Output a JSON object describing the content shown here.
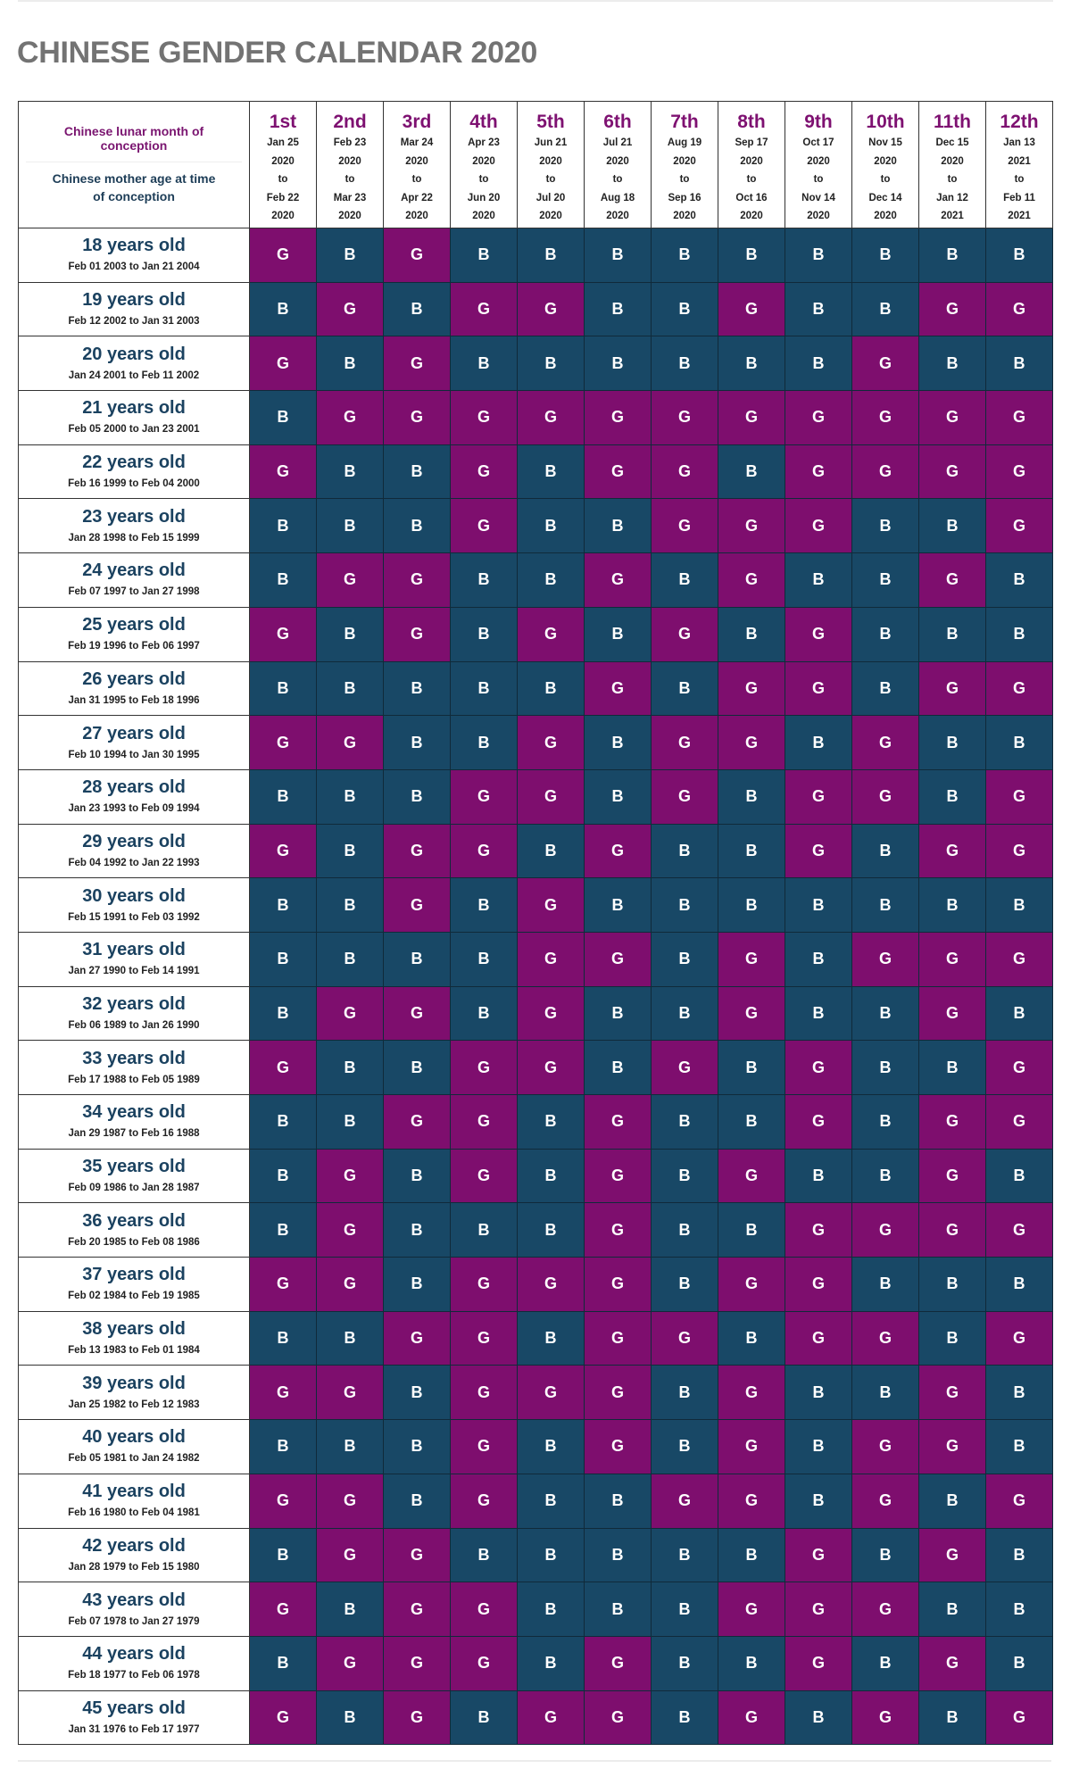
{
  "title": "CHINESE GENDER CALENDAR 2020",
  "header": {
    "lunar_label": "Chinese lunar month of conception",
    "mother_label": "Chinese mother age at time of conception",
    "connector": "to"
  },
  "colors": {
    "girl": "#7e0e6e",
    "boy": "#184866",
    "month_heading": "#7e1171",
    "age_heading": "#1b4260",
    "title": "#737373"
  },
  "months": [
    {
      "label": "1st",
      "from": "Jan 25",
      "from_year": "2020",
      "to": "Feb 22",
      "to_year": "2020"
    },
    {
      "label": "2nd",
      "from": "Feb 23",
      "from_year": "2020",
      "to": "Mar 23",
      "to_year": "2020"
    },
    {
      "label": "3rd",
      "from": "Mar 24",
      "from_year": "2020",
      "to": "Apr 22",
      "to_year": "2020"
    },
    {
      "label": "4th",
      "from": "Apr 23",
      "from_year": "2020",
      "to": "Jun 20",
      "to_year": "2020"
    },
    {
      "label": "5th",
      "from": "Jun 21",
      "from_year": "2020",
      "to": "Jul 20",
      "to_year": "2020"
    },
    {
      "label": "6th",
      "from": "Jul 21",
      "from_year": "2020",
      "to": "Aug 18",
      "to_year": "2020"
    },
    {
      "label": "7th",
      "from": "Aug 19",
      "from_year": "2020",
      "to": "Sep 16",
      "to_year": "2020"
    },
    {
      "label": "8th",
      "from": "Sep 17",
      "from_year": "2020",
      "to": "Oct 16",
      "to_year": "2020"
    },
    {
      "label": "9th",
      "from": "Oct 17",
      "from_year": "2020",
      "to": "Nov 14",
      "to_year": "2020"
    },
    {
      "label": "10th",
      "from": "Nov 15",
      "from_year": "2020",
      "to": "Dec 14",
      "to_year": "2020"
    },
    {
      "label": "11th",
      "from": "Dec 15",
      "from_year": "2020",
      "to": "Jan 12",
      "to_year": "2021"
    },
    {
      "label": "12th",
      "from": "Jan 13",
      "from_year": "2021",
      "to": "Feb 11",
      "to_year": "2021"
    }
  ],
  "rows": [
    {
      "age": "18 years old",
      "range": "Feb 01 2003 to Jan 21 2004",
      "cells": [
        "G",
        "B",
        "G",
        "B",
        "B",
        "B",
        "B",
        "B",
        "B",
        "B",
        "B",
        "B"
      ]
    },
    {
      "age": "19 years old",
      "range": "Feb 12 2002 to Jan 31 2003",
      "cells": [
        "B",
        "G",
        "B",
        "G",
        "G",
        "B",
        "B",
        "G",
        "B",
        "B",
        "G",
        "G"
      ]
    },
    {
      "age": "20 years old",
      "range": "Jan 24 2001 to Feb 11 2002",
      "cells": [
        "G",
        "B",
        "G",
        "B",
        "B",
        "B",
        "B",
        "B",
        "B",
        "G",
        "B",
        "B"
      ]
    },
    {
      "age": "21 years old",
      "range": "Feb 05 2000 to Jan 23 2001",
      "cells": [
        "B",
        "G",
        "G",
        "G",
        "G",
        "G",
        "G",
        "G",
        "G",
        "G",
        "G",
        "G"
      ]
    },
    {
      "age": "22 years old",
      "range": "Feb 16 1999 to Feb 04 2000",
      "cells": [
        "G",
        "B",
        "B",
        "G",
        "B",
        "G",
        "G",
        "B",
        "G",
        "G",
        "G",
        "G"
      ]
    },
    {
      "age": "23 years old",
      "range": "Jan 28 1998 to Feb 15 1999",
      "cells": [
        "B",
        "B",
        "B",
        "G",
        "B",
        "B",
        "G",
        "G",
        "G",
        "B",
        "B",
        "G"
      ]
    },
    {
      "age": "24 years old",
      "range": "Feb 07 1997 to Jan 27 1998",
      "cells": [
        "B",
        "G",
        "G",
        "B",
        "B",
        "G",
        "B",
        "G",
        "B",
        "B",
        "G",
        "B"
      ]
    },
    {
      "age": "25 years old",
      "range": "Feb 19 1996 to Feb 06 1997",
      "cells": [
        "G",
        "B",
        "G",
        "B",
        "G",
        "B",
        "G",
        "B",
        "G",
        "B",
        "B",
        "B"
      ]
    },
    {
      "age": "26 years old",
      "range": "Jan 31 1995 to Feb 18 1996",
      "cells": [
        "B",
        "B",
        "B",
        "B",
        "B",
        "G",
        "B",
        "G",
        "G",
        "B",
        "G",
        "G"
      ]
    },
    {
      "age": "27 years old",
      "range": "Feb 10 1994 to Jan 30 1995",
      "cells": [
        "G",
        "G",
        "B",
        "B",
        "G",
        "B",
        "G",
        "G",
        "B",
        "G",
        "B",
        "B"
      ]
    },
    {
      "age": "28 years old",
      "range": "Jan 23 1993 to Feb 09 1994",
      "cells": [
        "B",
        "B",
        "B",
        "G",
        "G",
        "B",
        "G",
        "B",
        "G",
        "G",
        "B",
        "G"
      ]
    },
    {
      "age": "29 years old",
      "range": "Feb 04 1992 to Jan 22 1993",
      "cells": [
        "G",
        "B",
        "G",
        "G",
        "B",
        "G",
        "B",
        "B",
        "G",
        "B",
        "G",
        "G"
      ]
    },
    {
      "age": "30 years old",
      "range": "Feb 15 1991 to Feb 03 1992",
      "cells": [
        "B",
        "B",
        "G",
        "B",
        "G",
        "B",
        "B",
        "B",
        "B",
        "B",
        "B",
        "B"
      ]
    },
    {
      "age": "31 years old",
      "range": "Jan 27 1990 to Feb 14 1991",
      "cells": [
        "B",
        "B",
        "B",
        "B",
        "G",
        "G",
        "B",
        "G",
        "B",
        "G",
        "G",
        "G"
      ]
    },
    {
      "age": "32 years old",
      "range": "Feb 06 1989 to Jan 26 1990",
      "cells": [
        "B",
        "G",
        "G",
        "B",
        "G",
        "B",
        "B",
        "G",
        "B",
        "B",
        "G",
        "B"
      ]
    },
    {
      "age": "33 years old",
      "range": "Feb 17 1988 to Feb 05 1989",
      "cells": [
        "G",
        "B",
        "B",
        "G",
        "G",
        "B",
        "G",
        "B",
        "G",
        "B",
        "B",
        "G"
      ]
    },
    {
      "age": "34 years old",
      "range": "Jan 29 1987 to Feb 16 1988",
      "cells": [
        "B",
        "B",
        "G",
        "G",
        "B",
        "G",
        "B",
        "B",
        "G",
        "B",
        "G",
        "G"
      ]
    },
    {
      "age": "35 years old",
      "range": "Feb 09 1986 to Jan 28 1987",
      "cells": [
        "B",
        "G",
        "B",
        "G",
        "B",
        "G",
        "B",
        "G",
        "B",
        "B",
        "G",
        "B"
      ]
    },
    {
      "age": "36 years old",
      "range": "Feb 20 1985 to Feb 08 1986",
      "cells": [
        "B",
        "G",
        "B",
        "B",
        "B",
        "G",
        "B",
        "B",
        "G",
        "G",
        "G",
        "G"
      ]
    },
    {
      "age": "37 years old",
      "range": "Feb 02 1984 to Feb 19 1985",
      "cells": [
        "G",
        "G",
        "B",
        "G",
        "G",
        "G",
        "B",
        "G",
        "G",
        "B",
        "B",
        "B"
      ]
    },
    {
      "age": "38 years old",
      "range": "Feb 13 1983 to Feb 01 1984",
      "cells": [
        "B",
        "B",
        "G",
        "G",
        "B",
        "G",
        "G",
        "B",
        "G",
        "G",
        "B",
        "G"
      ]
    },
    {
      "age": "39 years old",
      "range": "Jan 25 1982 to Feb 12 1983",
      "cells": [
        "G",
        "G",
        "B",
        "G",
        "G",
        "G",
        "B",
        "G",
        "B",
        "B",
        "G",
        "B"
      ]
    },
    {
      "age": "40 years old",
      "range": "Feb 05 1981 to Jan 24 1982",
      "cells": [
        "B",
        "B",
        "B",
        "G",
        "B",
        "G",
        "B",
        "G",
        "B",
        "G",
        "G",
        "B"
      ]
    },
    {
      "age": "41 years old",
      "range": "Feb 16 1980 to Feb 04 1981",
      "cells": [
        "G",
        "G",
        "B",
        "G",
        "B",
        "B",
        "G",
        "G",
        "B",
        "G",
        "B",
        "G"
      ]
    },
    {
      "age": "42 years old",
      "range": "Jan 28 1979 to Feb 15 1980",
      "cells": [
        "B",
        "G",
        "G",
        "B",
        "B",
        "B",
        "B",
        "B",
        "G",
        "B",
        "G",
        "B"
      ]
    },
    {
      "age": "43 years old",
      "range": "Feb 07 1978 to Jan 27 1979",
      "cells": [
        "G",
        "B",
        "G",
        "G",
        "B",
        "B",
        "B",
        "G",
        "G",
        "G",
        "B",
        "B"
      ]
    },
    {
      "age": "44 years old",
      "range": "Feb 18 1977 to Feb 06 1978",
      "cells": [
        "B",
        "G",
        "G",
        "G",
        "B",
        "G",
        "B",
        "B",
        "G",
        "B",
        "G",
        "B"
      ]
    },
    {
      "age": "45 years old",
      "range": "Jan 31 1976 to Feb 17 1977",
      "cells": [
        "G",
        "B",
        "G",
        "B",
        "G",
        "G",
        "B",
        "G",
        "B",
        "G",
        "B",
        "G"
      ]
    }
  ]
}
